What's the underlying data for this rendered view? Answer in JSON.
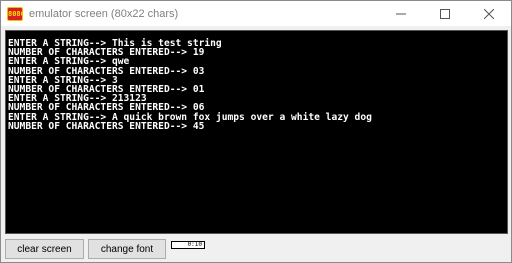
{
  "window": {
    "title": "emulator screen (80x22 chars)",
    "icon": "emu8086-icon",
    "icon_label": "8086",
    "controls": [
      "minimize-icon",
      "maximize-icon",
      "close-icon"
    ]
  },
  "screen": {
    "lines": [
      "ENTER A STRING--> This is test string",
      "NUMBER OF CHARACTERS ENTERED--> 19",
      "ENTER A STRING--> qwe",
      "NUMBER OF CHARACTERS ENTERED--> 03",
      "ENTER A STRING--> 3",
      "NUMBER OF CHARACTERS ENTERED--> 01",
      "ENTER A STRING--> 213123",
      "NUMBER OF CHARACTERS ENTERED--> 06",
      "ENTER A STRING--> A quick brown fox jumps over a white lazy dog",
      "NUMBER OF CHARACTERS ENTERED--> 45"
    ],
    "colors": {
      "background": "#000000",
      "text": "#ffffff"
    }
  },
  "toolbar": {
    "clear_label": "clear screen",
    "font_label": "change font",
    "status": "0:10"
  }
}
